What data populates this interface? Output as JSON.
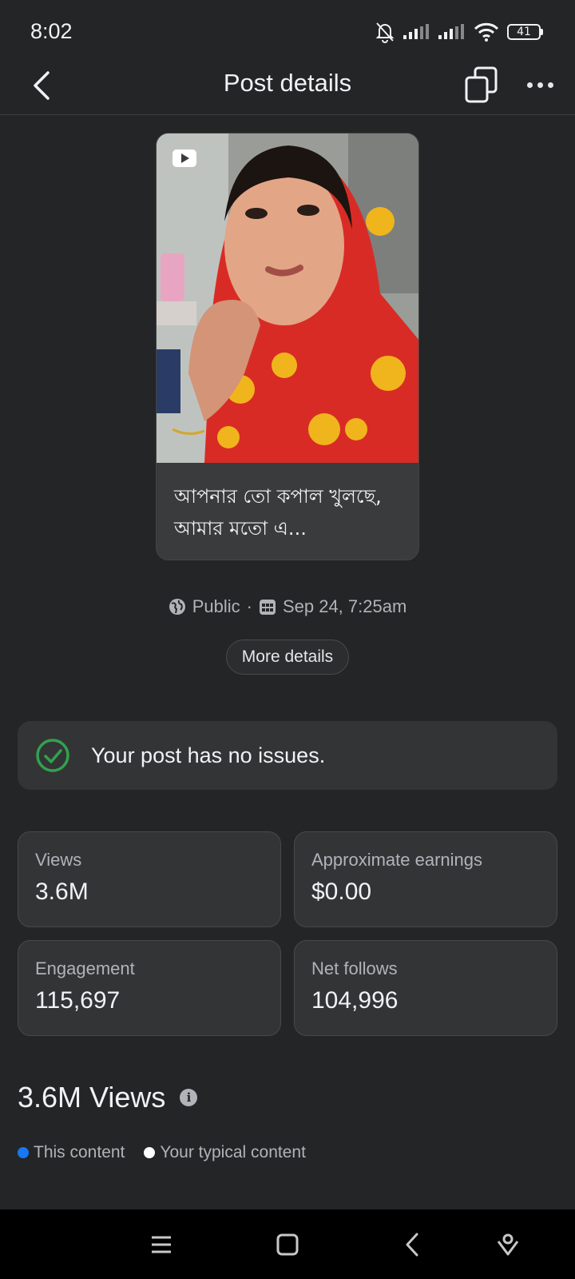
{
  "status_bar": {
    "time": "8:02",
    "battery": "41"
  },
  "header": {
    "title": "Post details"
  },
  "post": {
    "caption": "আপনার তো কপাল খুলছে, আমার মতো এ...",
    "visibility": "Public",
    "date": "Sep 24, 7:25am",
    "more_details_label": "More details"
  },
  "issues": {
    "message": "Your post has no issues."
  },
  "stats": [
    {
      "label": "Views",
      "value": "3.6M"
    },
    {
      "label": "Approximate earnings",
      "value": "$0.00"
    },
    {
      "label": "Engagement",
      "value": "115,697"
    },
    {
      "label": "Net follows",
      "value": "104,996"
    }
  ],
  "views_section": {
    "title": "3.6M Views",
    "legend": [
      {
        "label": "This content",
        "color": "#1877f2"
      },
      {
        "label": "Your typical content",
        "color": "#ffffff"
      }
    ]
  },
  "colors": {
    "background": "#242526",
    "card": "#333436",
    "success": "#31a24c"
  }
}
